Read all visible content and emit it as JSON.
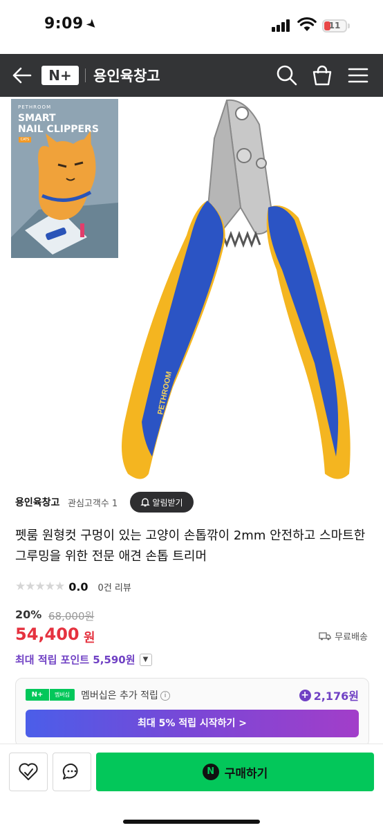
{
  "status_bar": {
    "time": "9:09",
    "battery": "11"
  },
  "header": {
    "logo": "N+",
    "store_name": "용인육창고"
  },
  "thumbnail": {
    "brand": "PETHROOM",
    "title_line1": "SMART",
    "title_line2": "NAIL CLIPPERS",
    "tag": "CATS"
  },
  "product_image": {
    "handle_text": "PETHROOM"
  },
  "seller": {
    "name": "용인육창고",
    "followers": "관심고객수 1",
    "alert_label": "알림받기"
  },
  "product": {
    "title": "펫룸 원형컷 구멍이 있는 고양이 손톱깎이 2mm 안전하고 스마트한 그루밍을 위한 전문 애견 손톱 트리머",
    "rating": "0.0",
    "rating_value": 0,
    "review_count": "0건 리뷰",
    "discount": "20%",
    "original_price": "68,000원",
    "price": "54,400",
    "price_unit": "원",
    "shipping": "무료배송"
  },
  "points": {
    "label": "최대 적립 포인트 5,590원"
  },
  "membership": {
    "badge_n": "N+",
    "badge_label": "멤버십",
    "text": "멤버십은 추가 적립",
    "points": "2,176원",
    "cta": "최대 5% 적립 시작하기 >"
  },
  "bottom_bar": {
    "buy_label": "구매하기",
    "buy_icon": "N"
  },
  "colors": {
    "header_bg": "#333436",
    "price_red": "#e5323f",
    "point_purple": "#7041c4",
    "naver_green": "#03c75a"
  }
}
